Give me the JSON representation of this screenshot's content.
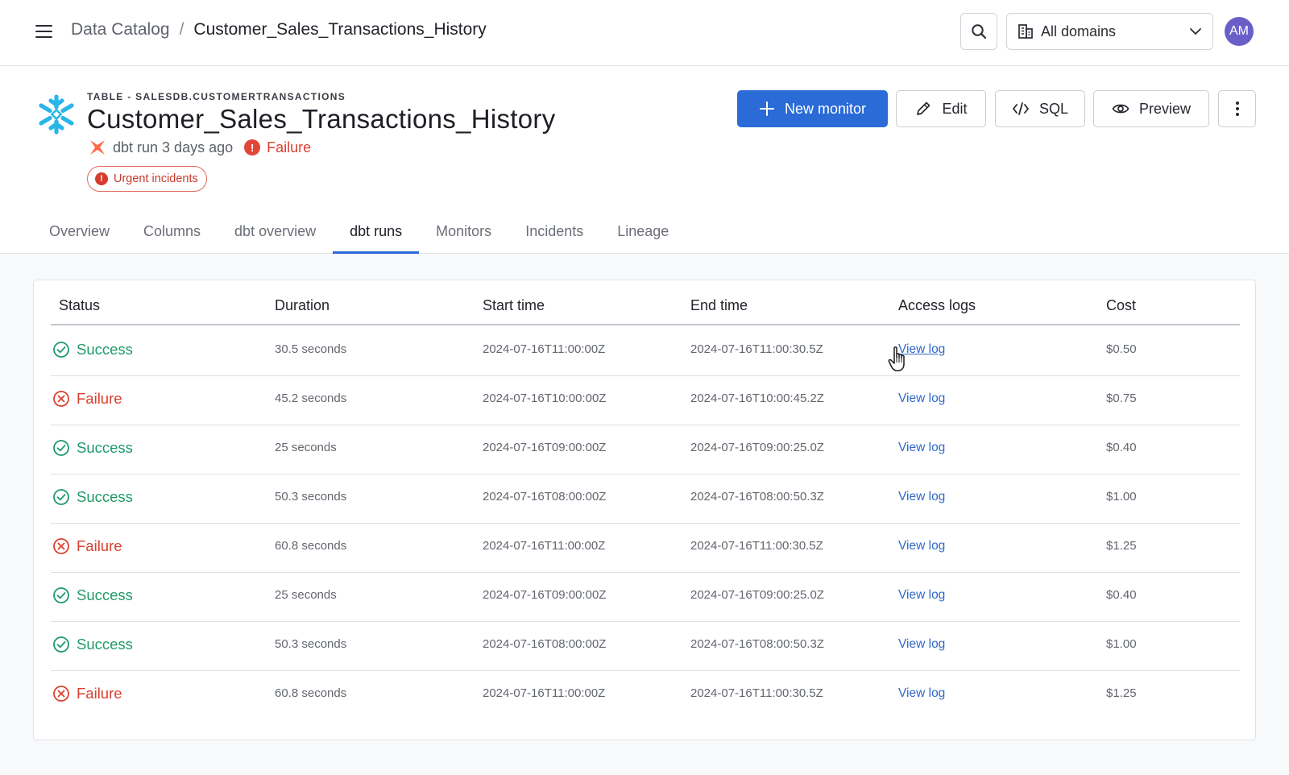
{
  "topbar": {
    "breadcrumb_root": "Data Catalog",
    "breadcrumb_separator": "/",
    "breadcrumb_current": "Customer_Sales_Transactions_History",
    "domain_select": "All domains",
    "avatar_initials": "AM"
  },
  "header": {
    "eyebrow": "TABLE - SALESDB.CUSTOMERTRANSACTIONS",
    "title": "Customer_Sales_Transactions_History",
    "dbt_run": "dbt run 3 days ago",
    "run_status": "Failure",
    "urgent_badge": "Urgent incidents"
  },
  "actions": {
    "new_monitor": "New monitor",
    "edit": "Edit",
    "sql": "SQL",
    "preview": "Preview"
  },
  "tabs": [
    {
      "label": "Overview"
    },
    {
      "label": "Columns"
    },
    {
      "label": "dbt overview"
    },
    {
      "label": "dbt runs"
    },
    {
      "label": "Monitors"
    },
    {
      "label": "Incidents"
    },
    {
      "label": "Lineage"
    }
  ],
  "active_tab": "dbt runs",
  "table": {
    "headers": {
      "status": "Status",
      "duration": "Duration",
      "start": "Start time",
      "end": "End time",
      "logs": "Access logs",
      "cost": "Cost"
    },
    "rows": [
      {
        "status": "Success",
        "duration": "30.5 seconds",
        "start": "2024-07-16T11:00:00Z",
        "end": "2024-07-16T11:00:30.5Z",
        "log": "View log",
        "cost": "$0.50"
      },
      {
        "status": "Failure",
        "duration": "45.2 seconds",
        "start": "2024-07-16T10:00:00Z",
        "end": "2024-07-16T10:00:45.2Z",
        "log": "View log",
        "cost": "$0.75"
      },
      {
        "status": "Success",
        "duration": "25 seconds",
        "start": "2024-07-16T09:00:00Z",
        "end": "2024-07-16T09:00:25.0Z",
        "log": "View log",
        "cost": "$0.40"
      },
      {
        "status": "Success",
        "duration": "50.3 seconds",
        "start": "2024-07-16T08:00:00Z",
        "end": "2024-07-16T08:00:50.3Z",
        "log": "View log",
        "cost": "$1.00"
      },
      {
        "status": "Failure",
        "duration": "60.8 seconds",
        "start": "2024-07-16T11:00:00Z",
        "end": "2024-07-16T11:00:30.5Z",
        "log": "View log",
        "cost": "$1.25"
      },
      {
        "status": "Success",
        "duration": "25 seconds",
        "start": "2024-07-16T09:00:00Z",
        "end": "2024-07-16T09:00:25.0Z",
        "log": "View log",
        "cost": "$0.40"
      },
      {
        "status": "Success",
        "duration": "50.3 seconds",
        "start": "2024-07-16T08:00:00Z",
        "end": "2024-07-16T08:00:50.3Z",
        "log": "View log",
        "cost": "$1.00"
      },
      {
        "status": "Failure",
        "duration": "60.8 seconds",
        "start": "2024-07-16T11:00:00Z",
        "end": "2024-07-16T11:00:30.5Z",
        "log": "View log",
        "cost": "$1.25"
      }
    ]
  },
  "colors": {
    "accent": "#2a6bd8",
    "success": "#1f9a6a",
    "failure": "#d8412f",
    "avatar": "#6a5fc8",
    "snowflake": "#29b5e8",
    "dbt": "#ff694a"
  },
  "icons": {
    "menu": "hamburger-icon",
    "search": "search-icon",
    "domain": "building-icon",
    "dropdown": "chevron-down-icon",
    "source": "snowflake-icon",
    "dbt": "dbt-icon",
    "alert": "alert-circle-icon",
    "add": "plus-icon",
    "edit": "pencil-icon",
    "sql": "code-icon",
    "preview": "eye-icon",
    "more": "kebab-icon",
    "success": "check-circle-icon",
    "failure": "x-circle-icon",
    "cursor": "hand-pointer-icon"
  }
}
